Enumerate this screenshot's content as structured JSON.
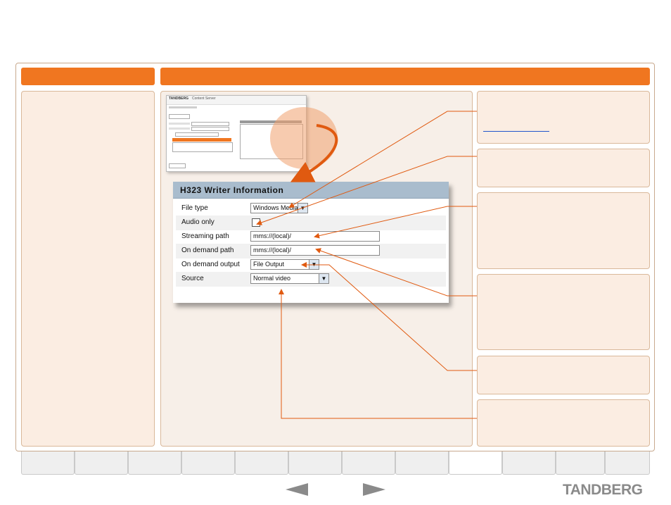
{
  "mini_screen": {
    "logo": "TANDBERG",
    "title": "Content Server"
  },
  "writer_panel": {
    "title": "H323 Writer Information",
    "fields": {
      "file_type": {
        "label": "File type",
        "value": "Windows Media"
      },
      "audio_only": {
        "label": "Audio only"
      },
      "streaming_path": {
        "label": "Streaming path",
        "value": "mms://(local)/"
      },
      "on_demand_path": {
        "label": "On demand path",
        "value": "mms://(local)/"
      },
      "on_demand_output": {
        "label": "On demand output",
        "value": "File Output"
      },
      "source": {
        "label": "Source",
        "value": "Normal video"
      }
    }
  },
  "brand": {
    "logo": "TANDBERG"
  },
  "colors": {
    "accent": "#f07620",
    "panel": "#fbede2",
    "header": "#a9bccd"
  },
  "icons": {
    "prev": "left-arrow-icon",
    "next": "right-arrow-icon",
    "select": "chevron-down-icon"
  }
}
